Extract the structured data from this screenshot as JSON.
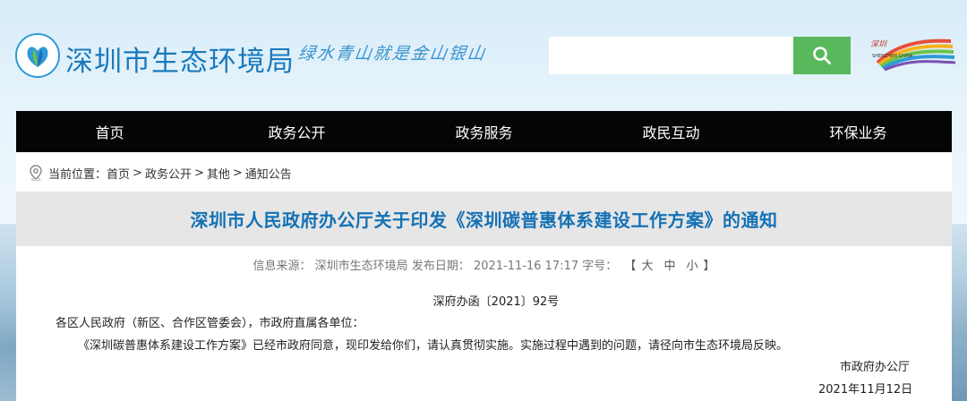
{
  "header": {
    "site_title": "深圳市生态环境局",
    "slogan": "绿水青山就是金山银山",
    "search_placeholder": "",
    "search_icon": "search-icon",
    "city_logo_text": "深圳 SHENZHEN CHINA"
  },
  "nav": {
    "items": [
      "首页",
      "政务公开",
      "政务服务",
      "政民互动",
      "环保业务"
    ]
  },
  "breadcrumb": {
    "label": "当前位置：",
    "items": [
      "首页",
      "政务公开",
      "其他",
      "通知公告"
    ],
    "separator": ">"
  },
  "article": {
    "title": "深圳市人民政府办公厅关于印发《深圳碳普惠体系建设工作方案》的通知",
    "source_label": "信息来源：",
    "source": "深圳市生态环境局",
    "date_label": "发布日期：",
    "date": "2021-11-16 17:17",
    "size_label": "字号：",
    "size_open": "【",
    "size_options": [
      "大",
      "中",
      "小"
    ],
    "size_close": "】",
    "doc_number": "深府办函〔2021〕92号",
    "recipient": "各区人民政府（新区、合作区管委会），市政府直属各单位：",
    "body": "《深圳碳普惠体系建设工作方案》已经市政府同意，现印发给你们，请认真贯彻实施。实施过程中遇到的问题，请径向市生态环境局反映。",
    "signature_office": "市政府办公厅",
    "signature_date": "2021年11月12日"
  },
  "colors": {
    "brand_blue": "#1b79bd",
    "title_blue": "#1571b5",
    "nav_bg": "#050505",
    "search_green": "#5ab85c",
    "title_band": "#e6e6e6"
  }
}
